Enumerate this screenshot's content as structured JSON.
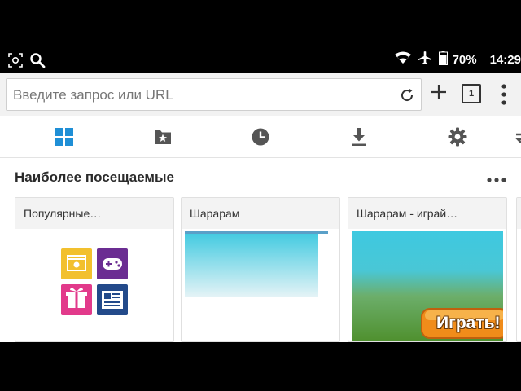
{
  "status_bar": {
    "battery": "70%",
    "time": "14:29",
    "icons": [
      "screenshot-icon",
      "search-icon",
      "wifi-icon",
      "airplane-icon",
      "battery-icon"
    ]
  },
  "toolbar": {
    "url_placeholder": "Введите запрос или URL",
    "tab_count": "1"
  },
  "nav_icons": [
    "top-sites-icon",
    "bookmarks-icon",
    "history-icon",
    "downloads-icon",
    "settings-icon",
    "sync-icon"
  ],
  "section": {
    "title": "Наиболее посещаемые"
  },
  "tiles": [
    {
      "title": "Популярные…"
    },
    {
      "title": "Шарарам"
    },
    {
      "title": "Шарарам - играй…",
      "thumb_button": "Играть!"
    }
  ],
  "colors": {
    "grid_blue": "#1f8fd6",
    "tile_yellow": "#f2c02e",
    "tile_purple": "#6b2d92",
    "tile_pink": "#e23a8b",
    "tile_navy": "#234a8a",
    "sky": "#3ec9e0",
    "grass": "#4e8f2c",
    "play_orange": "#f08c1a"
  }
}
